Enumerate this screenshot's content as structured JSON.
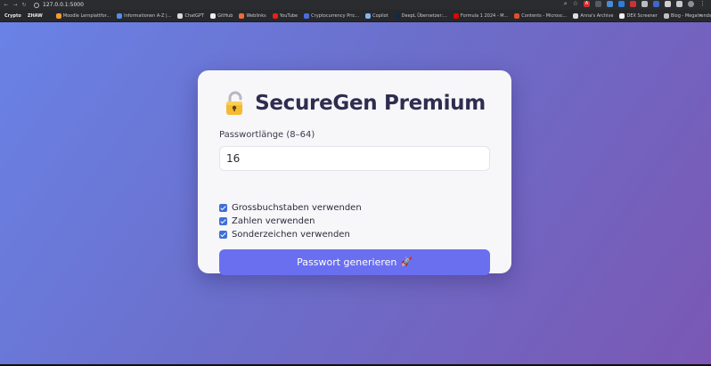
{
  "browser": {
    "url": "127.0.0.1:5000",
    "colors": {
      "toolbar": "#2b2c30",
      "bookmarks_bar": "#27282c"
    },
    "extensions": [
      {
        "name": "acrobat-icon",
        "color": "#d32f2f",
        "glyph": "A"
      },
      {
        "name": "grammar-icon",
        "color": "#555a66",
        "glyph": ""
      },
      {
        "name": "translate-icon",
        "color": "#4a8bd8",
        "glyph": ""
      },
      {
        "name": "proxy-icon",
        "color": "#2b7de0",
        "glyph": ""
      },
      {
        "name": "shield-icon",
        "color": "#c9343a",
        "glyph": ""
      },
      {
        "name": "notes-icon",
        "color": "#bbbcc2",
        "glyph": ""
      },
      {
        "name": "reader-icon",
        "color": "#3d67c9",
        "glyph": ""
      },
      {
        "name": "grid-icon",
        "color": "#d0d0d0",
        "glyph": ""
      },
      {
        "name": "puzzle-icon",
        "color": "#c7c8cc",
        "glyph": ""
      }
    ]
  },
  "bookmarks": [
    {
      "label": "Crypto",
      "bold": true,
      "icon_color": ""
    },
    {
      "label": "ZHAW",
      "bold": true,
      "icon_color": ""
    },
    {
      "label": "Moodle Lernplattfor...",
      "icon_color": "#f29c2e"
    },
    {
      "label": "Informationen A-Z |...",
      "icon_color": "#4f8ee8"
    },
    {
      "label": "ChatGPT",
      "icon_color": "#d9d9d9"
    },
    {
      "label": "GitHub",
      "icon_color": "#ededed"
    },
    {
      "label": "Weblinks",
      "icon_color": "#ef6b3b"
    },
    {
      "label": "YouTube",
      "icon_color": "#e62117"
    },
    {
      "label": "Cryptocurrency Pric...",
      "icon_color": "#4a6de0"
    },
    {
      "label": "Copilot",
      "icon_color": "#7fb7f0"
    },
    {
      "label": "DeepL Übersetzer:...",
      "icon_color": "#0f2b46"
    },
    {
      "label": "Formula 1 2024 - M...",
      "icon_color": "#e10600"
    },
    {
      "label": "Contents - Microsc...",
      "icon_color": "#e34d2f"
    },
    {
      "label": "Anna's Archive",
      "icon_color": "#dddddd"
    },
    {
      "label": "DEX Screener",
      "icon_color": "#f0f0f0"
    },
    {
      "label": "Blog - Megatrends",
      "icon_color": "#bfbfbf"
    }
  ],
  "app": {
    "title": "SecureGen Premium",
    "length_label": "Passwortlänge (8–64)",
    "length_value": "16",
    "options": [
      {
        "label": "Grossbuchstaben verwenden",
        "checked": true
      },
      {
        "label": "Zahlen verwenden",
        "checked": true
      },
      {
        "label": "Sonderzeichen verwenden",
        "checked": true
      }
    ],
    "generate_label": "Passwort generieren",
    "generate_emoji": "🚀",
    "colors": {
      "gradient_start": "#6a82e6",
      "gradient_end": "#7a58b4",
      "button": "#6a6ff0",
      "checkbox": "#3f6fd6",
      "title": "#2f2d4f"
    }
  }
}
